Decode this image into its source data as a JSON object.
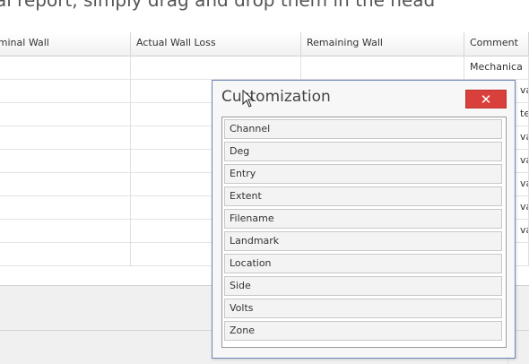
{
  "banner_text": "al report, simply drag and drop them in the head",
  "grid": {
    "columns": [
      "lominal Wall",
      "Actual Wall Loss",
      "Remaining Wall",
      "Comment"
    ],
    "first_row_comment": "Mechanica",
    "comment_fragments": [
      "var",
      "ted",
      "var",
      "var",
      "var",
      "var",
      "var"
    ]
  },
  "dialog": {
    "title": "Customization",
    "close_label": "✕",
    "fields": [
      "Channel",
      "Deg",
      "Entry",
      "Extent",
      "Filename",
      "Landmark",
      "Location",
      "Side",
      "Volts",
      "Zone"
    ]
  },
  "icons": {
    "close": "close-icon",
    "cursor": "mouse-cursor-icon"
  },
  "colors": {
    "close_button": "#d9403b",
    "dialog_border": "#6b87b7"
  }
}
